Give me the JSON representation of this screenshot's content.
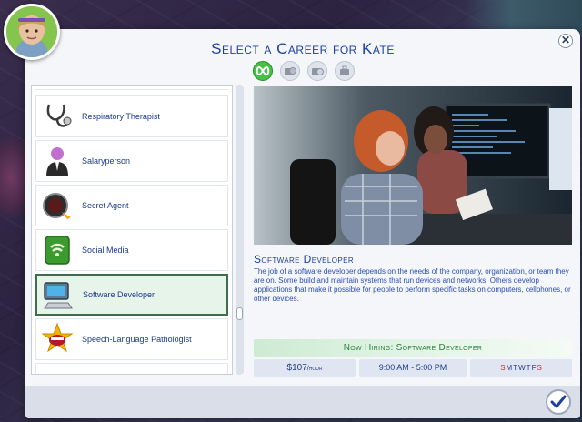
{
  "dialog": {
    "title": "Select a Career for Kate",
    "close_symbol": "✕"
  },
  "filters": [
    {
      "name": "all-careers-icon",
      "active": true
    },
    {
      "name": "full-time-icon",
      "active": false
    },
    {
      "name": "part-time-icon",
      "active": false
    },
    {
      "name": "freelance-icon",
      "active": false
    }
  ],
  "career_list": [
    {
      "label": "Respiratory Therapist",
      "icon": "stethoscope-icon"
    },
    {
      "label": "Salaryperson",
      "icon": "briefcase-person-icon"
    },
    {
      "label": "Secret Agent",
      "icon": "watch-gadget-icon"
    },
    {
      "label": "Social Media",
      "icon": "wifi-phone-icon"
    },
    {
      "label": "Software Developer",
      "icon": "computer-icon",
      "selected": true
    },
    {
      "label": "Speech-Language Pathologist",
      "icon": "mouth-speech-icon"
    }
  ],
  "detail": {
    "title": "Software Developer",
    "description": "The job of a software developer depends on the needs of the company, organization, or team they are on. Some build and maintain systems that run devices and networks. Others develop applications that make it possible for people to perform specific tasks on computers, cellphones, or other devices.",
    "hiring": "Now Hiring: Software Developer",
    "pay_amount": "$107",
    "pay_unit": "/hour",
    "hours": "9:00 AM - 5:00 PM",
    "days": [
      {
        "letter": "S",
        "off": true
      },
      {
        "letter": "M",
        "off": false
      },
      {
        "letter": "T",
        "off": false
      },
      {
        "letter": "W",
        "off": false
      },
      {
        "letter": "T",
        "off": false
      },
      {
        "letter": "F",
        "off": false
      },
      {
        "letter": "S",
        "off": true
      }
    ]
  },
  "colors": {
    "title_blue": "#1d3f9e",
    "hiring_green": "#2e7d3a",
    "selected_bg": "#e6f4e9",
    "day_off_red": "#d12727"
  }
}
